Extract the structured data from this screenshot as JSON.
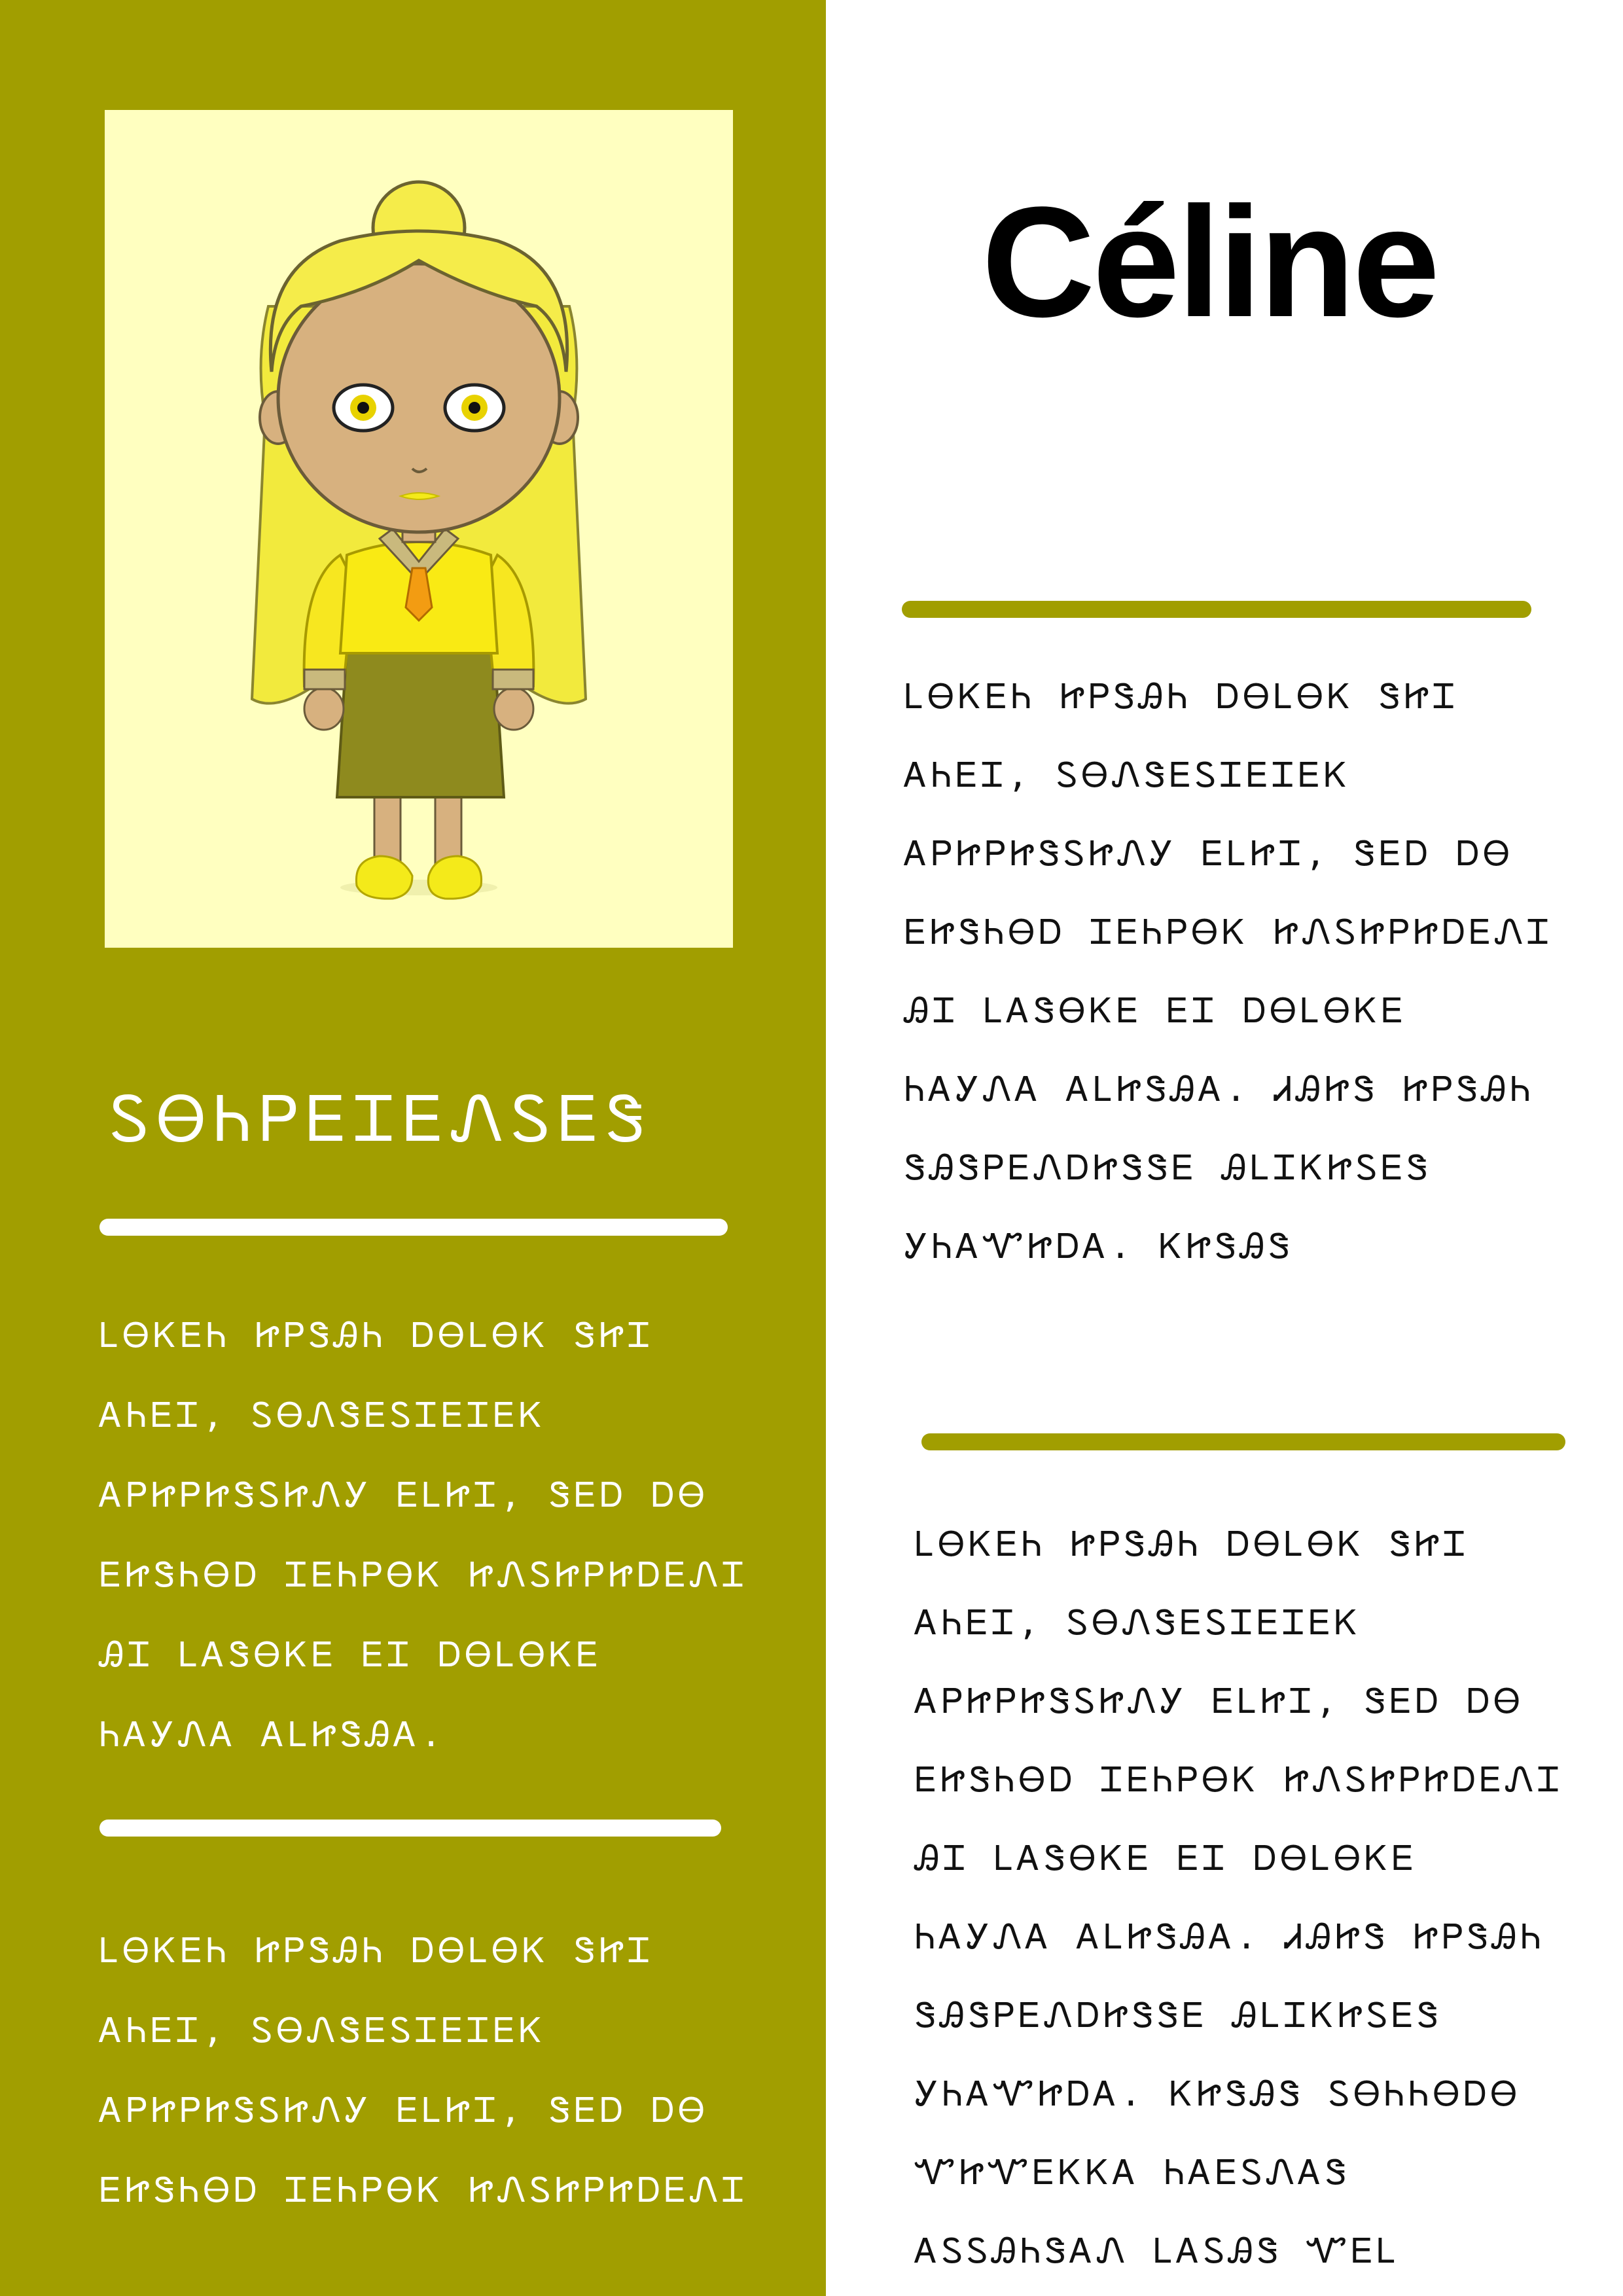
{
  "profile": {
    "name": "Céline",
    "colors": {
      "accent": "#a19e00",
      "portrait_background": "#ffffc0",
      "text_light": "#ffffff",
      "text_dark": "#111111"
    }
  },
  "sidebar": {
    "heading": "ᏚᎾᏂᏢᎬᏆᎬᏁᏚᎬᏕ",
    "paragraph_1": "ᏞᎾᏦᎬᏂ ᏥᏢᏕᎯᏂ ᎠᎾᏞᎾᏦ ᏕᏥᏆ ᎪᏂᎬᏆ, ᏚᎾᏁᏕᎬᏚᏆᎬᏆᎬᏦ ᎪᏢᏥᏢᏥᏕᏚᏥᏁᎩ ᎬᏞᏥᏆ, ᏕᎬᎠ ᎠᎾ ᎬᏥᏕᏂᎾᎠ ᏆᎬᏂᏢᎾᏦ ᏥᏁᏚᏥᏢᏥᎠᎬᏁᏆ ᎯᏆ ᏞᎪᏕᎾᏦᎬ ᎬᏆ ᎠᎾᏞᎾᏦᎬ ᏂᎪᎩᏁᎪ ᎪᏞᏥᏕᎯᎪ.",
    "paragraph_2": "ᏞᎾᏦᎬᏂ ᏥᏢᏕᎯᏂ ᎠᎾᏞᎾᏦ ᏕᏥᏆ ᎪᏂᎬᏆ, ᏚᎾᏁᏕᎬᏚᏆᎬᏆᎬᏦ ᎪᏢᏥᏢᏥᏕᏚᏥᏁᎩ ᎬᏞᏥᏆ, ᏕᎬᎠ ᎠᎾ ᎬᏥᏕᏂᎾᎠ ᏆᎬᏂᏢᎾᏦ ᏥᏁᏚᏥᏢᏥᎠᎬᏁᏆ"
  },
  "main": {
    "paragraph_1": "ᏞᎾᏦᎬᏂ ᏥᏢᏕᎯᏂ ᎠᎾᏞᎾᏦ ᏕᏥᏆ ᎪᏂᎬᏆ, ᏚᎾᏁᏕᎬᏚᏆᎬᏆᎬᏦ ᎪᏢᏥᏢᏥᏕᏚᏥᏁᎩ ᎬᏞᏥᏆ, ᏕᎬᎠ ᎠᎾ ᎬᏥᏕᏂᎾᎠ ᏆᎬᏂᏢᎾᏦ ᏥᏁᏚᏥᏢᏥᎠᎬᏁᏆ ᎯᏆ ᏞᎪᏕᎾᏦᎬ ᎬᏆ ᎠᎾᏞᎾᏦᎬ ᏂᎪᎩᏁᎪ ᎪᏞᏥᏕᎯᎪ. ᏗᎯᏥᏕ ᏥᏢᏕᎯᏂ ᏕᎯᏕᏢᎬᏁᎠᏥᏕᏕᎬ ᎯᏞᏆᏦᏥᏚᎬᏕ ᎩᏂᎪᏉᏥᎠᎪ. ᏦᏥᏕᎯᏕ",
    "paragraph_2": "ᏞᎾᏦᎬᏂ ᏥᏢᏕᎯᏂ ᎠᎾᏞᎾᏦ ᏕᏥᏆ ᎪᏂᎬᏆ, ᏚᎾᏁᏕᎬᏚᏆᎬᏆᎬᏦ ᎪᏢᏥᏢᏥᏕᏚᏥᏁᎩ ᎬᏞᏥᏆ, ᏕᎬᎠ ᎠᎾ ᎬᏥᏕᏂᎾᎠ ᏆᎬᏂᏢᎾᏦ ᏥᏁᏚᏥᏢᏥᎠᎬᏁᏆ ᎯᏆ ᏞᎪᏕᎾᏦᎬ ᎬᏆ ᎠᎾᏞᎾᏦᎬ ᏂᎪᎩᏁᎪ ᎪᏞᏥᏕᎯᎪ. ᏗᎯᏥᏕ ᏥᏢᏕᎯᏂ ᏕᎯᏕᏢᎬᏁᎠᏥᏕᏕᎬ ᎯᏞᏆᏦᏥᏚᎬᏕ ᎩᏂᎪᏉᏥᎠᎪ. ᏦᏥᏕᎯᏕ ᏚᎾᏂᏂᎾᎠᎾ ᏉᏥᏉᎬᏦᏦᎪ ᏂᎪᎬᏚᏁᎪᏕ ᎪᏚᏚᎯᏂᏕᎪᏁ ᏞᎪᏚᎯᏕ ᏉᎬᏞ"
  }
}
